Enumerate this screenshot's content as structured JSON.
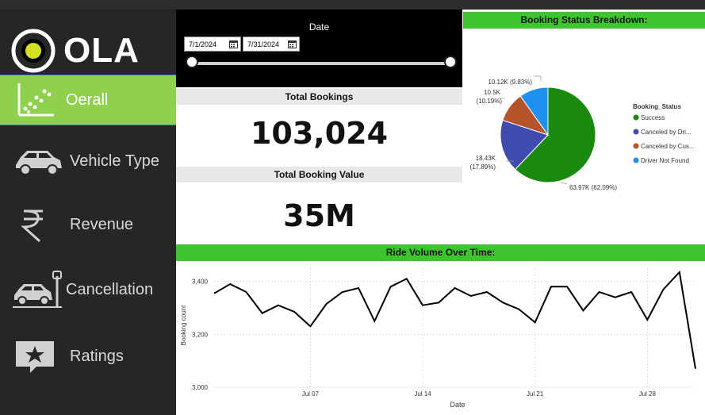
{
  "app": {
    "brand": "OLA"
  },
  "sidebar": {
    "items": [
      {
        "label": "Oerall",
        "icon": "scatter-chart-icon",
        "active": true
      },
      {
        "label": "Vehicle Type",
        "icon": "car-icon",
        "active": false
      },
      {
        "label": "Revenue",
        "icon": "rupee-icon",
        "active": false
      },
      {
        "label": "Cancellation",
        "icon": "parked-car-icon",
        "active": false
      },
      {
        "label": "Ratings",
        "icon": "star-chat-icon",
        "active": false
      }
    ]
  },
  "filter": {
    "title": "Date",
    "start_date": "7/1/2024",
    "end_date": "7/31/2024"
  },
  "kpis": {
    "total_bookings_label": "Total Bookings",
    "total_bookings_value": "103,024",
    "total_booking_value_label": "Total Booking Value",
    "total_booking_value_value": "35M"
  },
  "colors": {
    "accent_green": "#3ec42e",
    "nav_active": "#8fd14f",
    "success": "#1a8a0f",
    "canceled_driver": "#3f4cae",
    "canceled_customer": "#b5532a",
    "driver_not_found": "#1e90f0"
  },
  "chart_data": [
    {
      "type": "pie",
      "title": "Booking Status Breakdown:",
      "legend_title": "Booking_Status",
      "legend_placement": "right",
      "slices": [
        {
          "name": "Success",
          "legend_label": "Success",
          "value": 63970,
          "percent": 62.09,
          "label": "63.97K (62.09%)"
        },
        {
          "name": "Canceled by Driver",
          "legend_label": "Canceled by Dri...",
          "value": 18430,
          "percent": 17.89,
          "label_line1": "18.43K",
          "label_line2": "(17.89%)"
        },
        {
          "name": "Canceled by Customer",
          "legend_label": "Canceled by Cus...",
          "value": 10500,
          "percent": 10.19,
          "label_line1": "10.5K",
          "label_line2": "(10.19%)"
        },
        {
          "name": "Driver Not Found",
          "legend_label": "Driver Not Found",
          "value": 10120,
          "percent": 9.83,
          "label": "10.12K (9.83%)"
        }
      ]
    },
    {
      "type": "line",
      "title": "Ride Volume Over Time:",
      "xlabel": "Date",
      "ylabel": "Booking count",
      "ylim": [
        3000,
        3450
      ],
      "yticks": [
        3000,
        3200,
        3400
      ],
      "ytick_labels": [
        "3,000",
        "3,200",
        "3,400"
      ],
      "xticks": [
        7,
        14,
        21,
        28
      ],
      "xtick_labels": [
        "Jul 07",
        "Jul 14",
        "Jul 21",
        "Jul 28"
      ],
      "x": [
        1,
        2,
        3,
        4,
        5,
        6,
        7,
        8,
        9,
        10,
        11,
        12,
        13,
        14,
        15,
        16,
        17,
        18,
        19,
        20,
        21,
        22,
        23,
        24,
        25,
        26,
        27,
        28,
        29,
        30,
        31
      ],
      "values": [
        3355,
        3390,
        3360,
        3280,
        3310,
        3285,
        3230,
        3315,
        3360,
        3375,
        3250,
        3380,
        3410,
        3310,
        3320,
        3375,
        3345,
        3360,
        3320,
        3295,
        3245,
        3380,
        3380,
        3290,
        3360,
        3340,
        3360,
        3255,
        3370,
        3435,
        3070
      ],
      "grid": true
    }
  ]
}
